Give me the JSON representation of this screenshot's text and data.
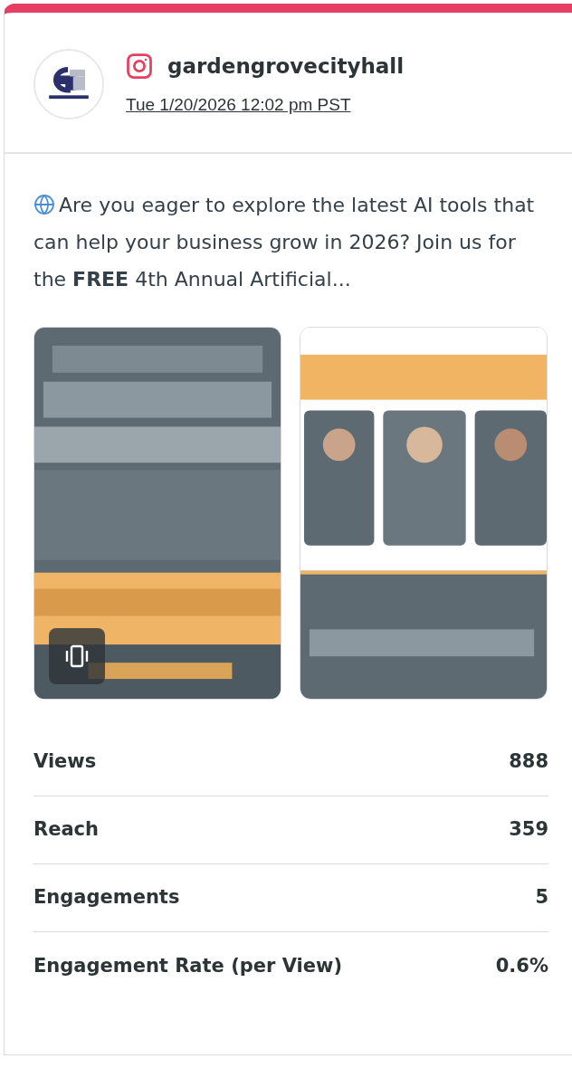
{
  "account": {
    "kind": "instagram",
    "handle": "gardengrovecityhall",
    "timestamp": "Tue 1/20/2026 12:02 pm PST",
    "avatar": {
      "kind": "picture"
    }
  },
  "post": {
    "text": "Are you eager to explore the latest AI tools that can help your business grow in 2026? Join us for the **FREE** 4th Annual Artificial...",
    "media": [
      {
        "kind": "picture",
        "carousel": true
      },
      {
        "kind": "picture",
        "carousel": false
      }
    ]
  },
  "stats": [
    {
      "label": "Views",
      "value": "888"
    },
    {
      "label": "Reach",
      "value": "359"
    },
    {
      "label": "Engagements",
      "value": "5"
    },
    {
      "label": "Engagement Rate (per View)",
      "value": "0.6%"
    }
  ]
}
